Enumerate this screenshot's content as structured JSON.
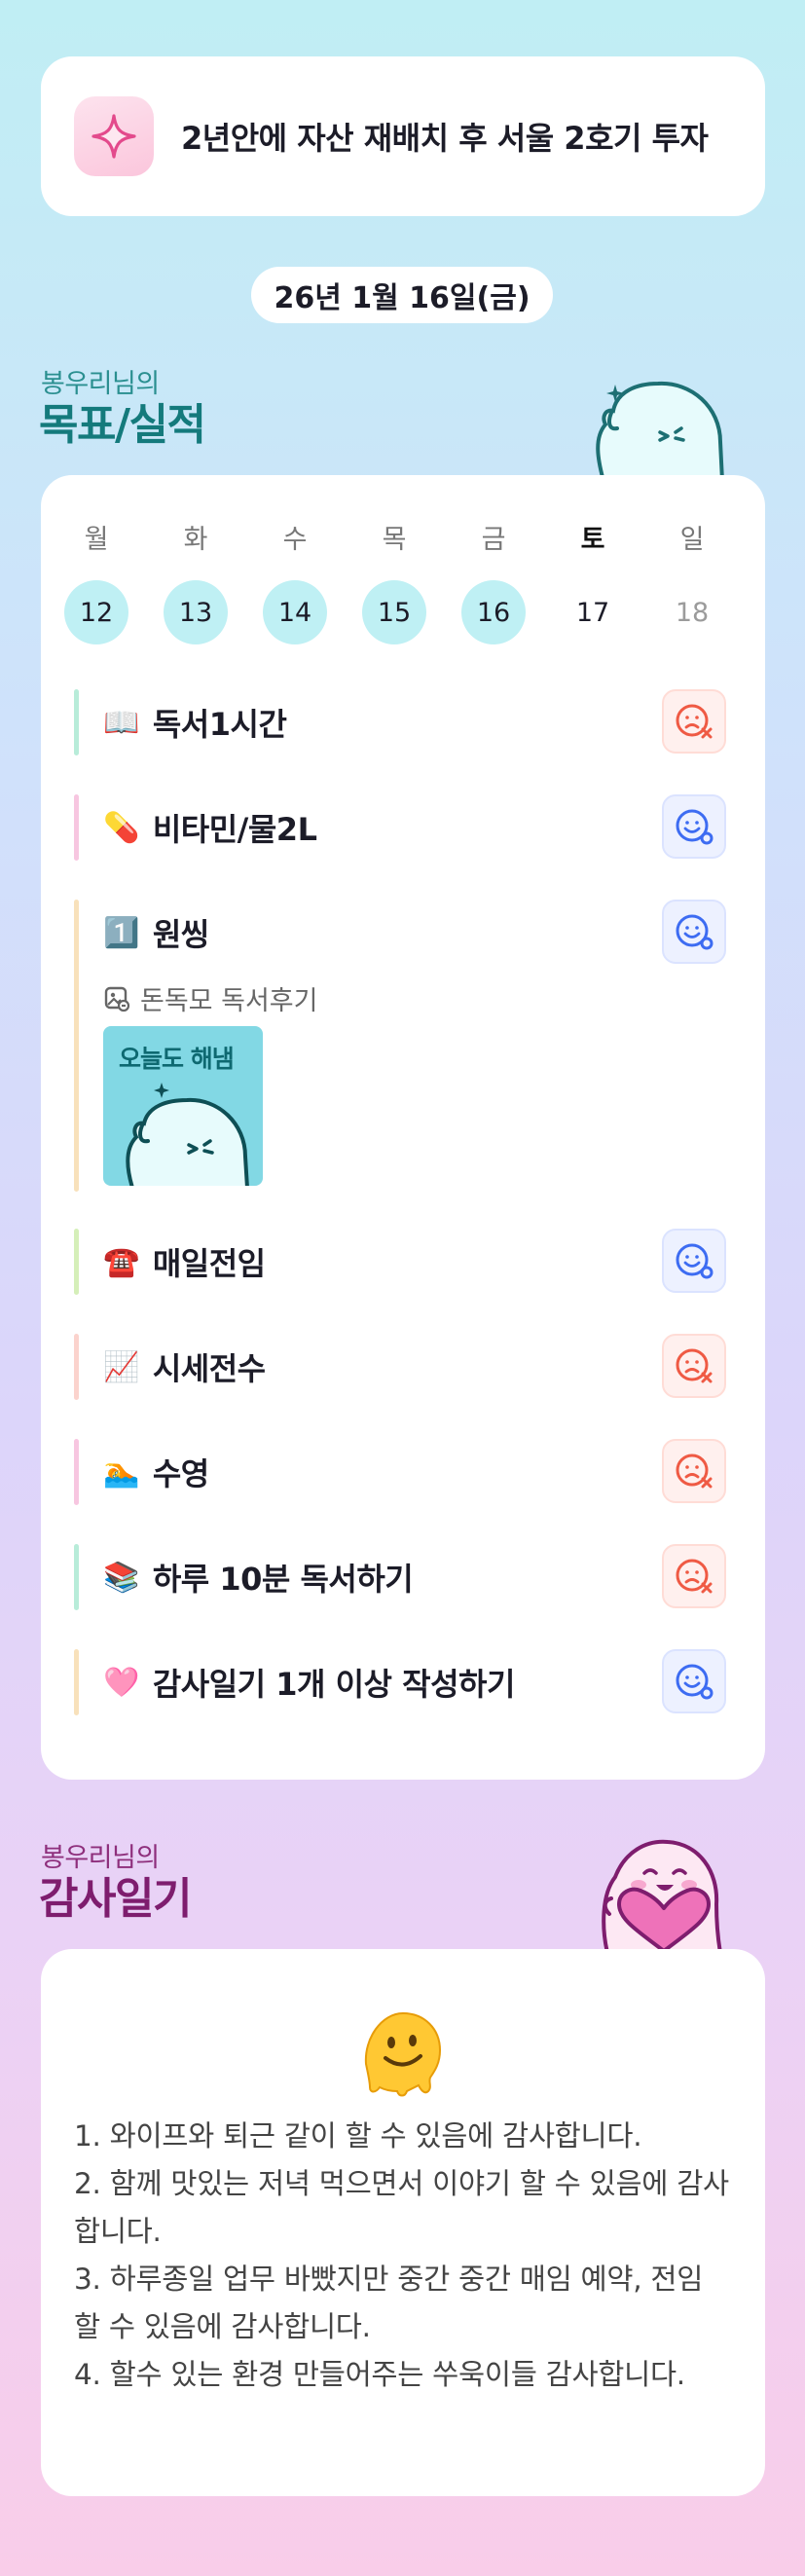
{
  "goal": {
    "text": "2년안에 자산 재배치 후 서울 2호기 투자",
    "icon": "sparkle-icon"
  },
  "date": "26년 1월 16일(금)",
  "goals_section": {
    "subtitle": "봉우리님의",
    "title": "목표/실적",
    "mascot": "waving-ghost-mascot"
  },
  "week": [
    {
      "day": "월",
      "date": "12",
      "done": true
    },
    {
      "day": "화",
      "date": "13",
      "done": true
    },
    {
      "day": "수",
      "date": "14",
      "done": true
    },
    {
      "day": "목",
      "date": "15",
      "done": true
    },
    {
      "day": "금",
      "date": "16",
      "done": true
    },
    {
      "day": "토",
      "date": "17",
      "done": false,
      "today": true
    },
    {
      "day": "일",
      "date": "18",
      "done": false
    }
  ],
  "tasks": [
    {
      "emoji": "📖",
      "label": "독서1시간",
      "status": "fail",
      "bar": "#b8ecd9"
    },
    {
      "emoji": "💊",
      "label": "비타민/물2L",
      "status": "success",
      "bar": "#f7c6e0"
    },
    {
      "emoji": "1️⃣",
      "label": "원씽",
      "status": "success",
      "bar": "#f8e1bb",
      "sub": {
        "label": "돈독모 독서후기",
        "image_text": "오늘도 해냄"
      }
    },
    {
      "emoji": "☎️",
      "label": "매일전임",
      "status": "success",
      "bar": "#d5efb9"
    },
    {
      "emoji": "📈",
      "label": "시세전수",
      "status": "fail",
      "bar": "#fbd3cd"
    },
    {
      "emoji": "🏊",
      "label": "수영",
      "status": "fail",
      "bar": "#f7c6e0"
    },
    {
      "emoji": "📚",
      "label": "하루 10분 독서하기",
      "status": "fail",
      "bar": "#b8ecd9"
    },
    {
      "emoji": "🩷",
      "label": "감사일기 1개 이상 작성하기",
      "status": "success",
      "bar": "#f8e1bb"
    }
  ],
  "colors": {
    "success": "#3d6cf2",
    "fail": "#ef5a44",
    "done_day": "#bff0f4"
  },
  "gratitude_section": {
    "subtitle": "봉우리님의",
    "title": "감사일기",
    "mascot": "heart-ghost-mascot",
    "emoji": "🫠"
  },
  "gratitude": [
    "1. 와이프와 퇴근 같이 할 수 있음에 감사합니다.",
    "2. 함께 맛있는 저녁 먹으면서 이야기 할 수 있음에 감사합니다.",
    "3. 하루종일 업무 바빴지만 중간 중간 매임 예약, 전임 할 수 있음에 감사합니다.",
    "4. 할수 있는 환경 만들어주는 쑤욱이들 감사합니다."
  ]
}
